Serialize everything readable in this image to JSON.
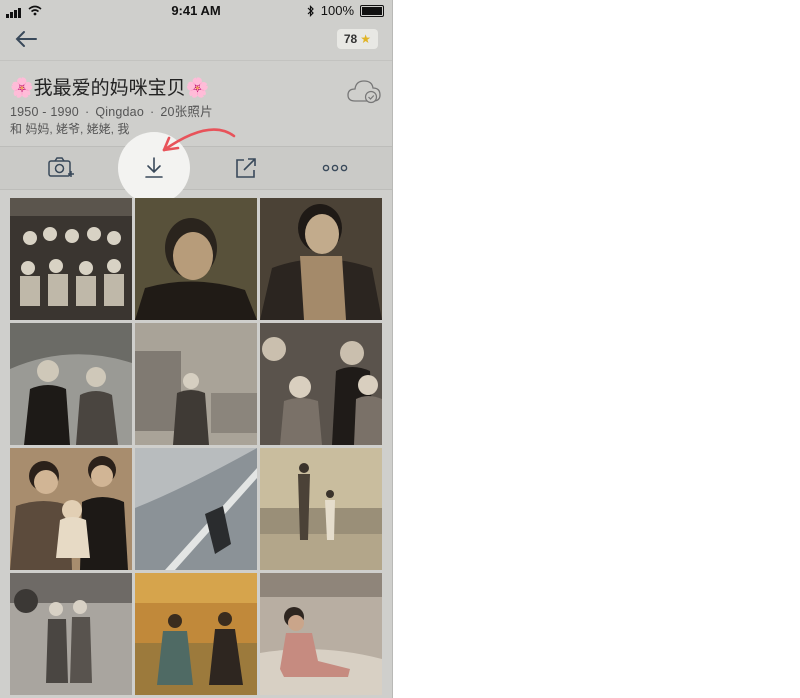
{
  "status_bar": {
    "time": "9:41 AM",
    "battery": "100%"
  },
  "navbar": {
    "back_icon": "arrow-left-icon",
    "badge_count": "78",
    "badge_icon": "star-icon"
  },
  "album": {
    "title": "🌸我最爱的妈咪宝贝🌸",
    "years": "1950 - 1990",
    "location": "Qingdao",
    "photo_count": "20张照片",
    "separator": "·",
    "people": "和 妈妈, 姥爷, 姥姥, 我",
    "sync_icon": "cloud-check-icon"
  },
  "actions": [
    {
      "name": "add-photo-button",
      "icon": "camera-plus-icon"
    },
    {
      "name": "download-button",
      "icon": "download-icon"
    },
    {
      "name": "share-button",
      "icon": "share-icon"
    },
    {
      "name": "more-button",
      "icon": "more-dots-icon"
    }
  ],
  "colors": {
    "accent_arrow": "#e8535a",
    "icon": "#39495a",
    "star": "#e0b324"
  },
  "photos": [
    {
      "desc": "group-portrait",
      "tint": "#3a3530"
    },
    {
      "desc": "woman-portrait",
      "tint": "#58513a"
    },
    {
      "desc": "woman-scarf-portrait",
      "tint": "#4b4236"
    },
    {
      "desc": "couple-outdoors",
      "tint": "#6b6b66"
    },
    {
      "desc": "woman-front-building",
      "tint": "#807a72"
    },
    {
      "desc": "family-with-children",
      "tint": "#5a534c"
    },
    {
      "desc": "couple-with-baby",
      "tint": "#5c4b3c"
    },
    {
      "desc": "person-by-wall",
      "tint": "#8b9297"
    },
    {
      "desc": "two-figures-landscape",
      "tint": "#9a8f78"
    },
    {
      "desc": "two-women-street",
      "tint": "#6e6a66"
    },
    {
      "desc": "couple-beach-sunset",
      "tint": "#9c7a3c"
    },
    {
      "desc": "woman-seated-beach",
      "tint": "#8f857a"
    }
  ]
}
